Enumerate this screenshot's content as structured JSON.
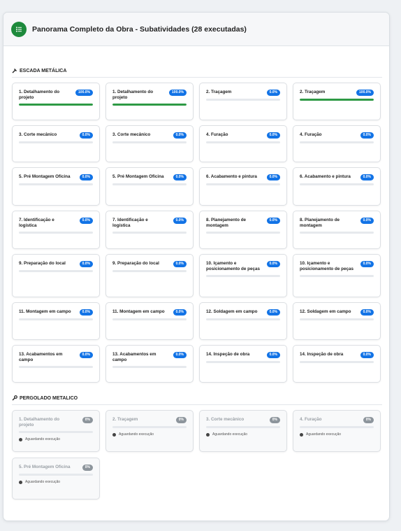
{
  "header": {
    "title": "Panorama Completo da Obra - Subatividades (28 executadas)"
  },
  "sections": [
    {
      "title": "ESCADA METÁLICA",
      "cards": [
        {
          "name": "1. Detalhamento do projeto",
          "badge": "100.0%",
          "progress": 1.0
        },
        {
          "name": "1. Detalhamento do projeto",
          "badge": "100.0%",
          "progress": 1.0
        },
        {
          "name": "2. Traçagem",
          "badge": "0.0%",
          "progress": 0
        },
        {
          "name": "2. Traçagem",
          "badge": "100.0%",
          "progress": 1.0
        },
        {
          "name": "3. Corte mecânico",
          "badge": "0.0%",
          "progress": 0
        },
        {
          "name": "3. Corte mecânico",
          "badge": "0.0%",
          "progress": 0
        },
        {
          "name": "4. Furação",
          "badge": "0.0%",
          "progress": 0
        },
        {
          "name": "4. Furação",
          "badge": "0.0%",
          "progress": 0
        },
        {
          "name": "5. Pré Montagem Oficina",
          "badge": "0.0%",
          "progress": 0
        },
        {
          "name": "5. Pré Montagem Oficina",
          "badge": "0.0%",
          "progress": 0
        },
        {
          "name": "6. Acabamento e pintura",
          "badge": "0.0%",
          "progress": 0
        },
        {
          "name": "6. Acabamento e pintura",
          "badge": "0.0%",
          "progress": 0
        },
        {
          "name": "7. Identificação e logística",
          "badge": "0.0%",
          "progress": 0
        },
        {
          "name": "7. Identificação e logística",
          "badge": "0.0%",
          "progress": 0
        },
        {
          "name": "8. Planejamento de montagem",
          "badge": "0.0%",
          "progress": 0
        },
        {
          "name": "8. Planejamento de montagem",
          "badge": "0.0%",
          "progress": 0
        },
        {
          "name": "9. Preparação do local",
          "badge": "0.0%",
          "progress": 0
        },
        {
          "name": "9. Preparação do local",
          "badge": "0.0%",
          "progress": 0
        },
        {
          "name": "10. Içamento e posicionamento de peças",
          "badge": "0.0%",
          "progress": 0
        },
        {
          "name": "10. Içamento e posicionamento de peças",
          "badge": "0.0%",
          "progress": 0
        },
        {
          "name": "11. Montagem em campo",
          "badge": "0.0%",
          "progress": 0
        },
        {
          "name": "11. Montagem em campo",
          "badge": "0.0%",
          "progress": 0
        },
        {
          "name": "12. Soldagem em campo",
          "badge": "0.0%",
          "progress": 0
        },
        {
          "name": "12. Soldagem em campo",
          "badge": "0.0%",
          "progress": 0
        },
        {
          "name": "13. Acabamentos em campo",
          "badge": "0.0%",
          "progress": 0
        },
        {
          "name": "13. Acabamentos em campo",
          "badge": "0.0%",
          "progress": 0
        },
        {
          "name": "14. Inspeção de obra",
          "badge": "0.0%",
          "progress": 0
        },
        {
          "name": "14. Inspeção de obra",
          "badge": "0.0%",
          "progress": 0
        }
      ]
    },
    {
      "title": "PERGOLADO METALICO",
      "pending_label": "Aguardando execução",
      "cards": [
        {
          "name": "1. Detalhamento do projeto",
          "badge": "0%"
        },
        {
          "name": "2. Traçagem",
          "badge": "0%"
        },
        {
          "name": "3. Corte mecânico",
          "badge": "0%"
        },
        {
          "name": "4. Furação",
          "badge": "0%"
        },
        {
          "name": "5. Pré Montagem Oficina",
          "badge": "0%"
        }
      ]
    }
  ],
  "colors": {
    "accent": "#1273e6",
    "success": "#2e9a45",
    "header_icon": "#1e8a3c",
    "pending_badge": "#8d959c"
  },
  "icons": {
    "header": "list-icon",
    "section1": "hammer-icon",
    "section2": "wrench-icon",
    "pending": "clock-icon"
  }
}
